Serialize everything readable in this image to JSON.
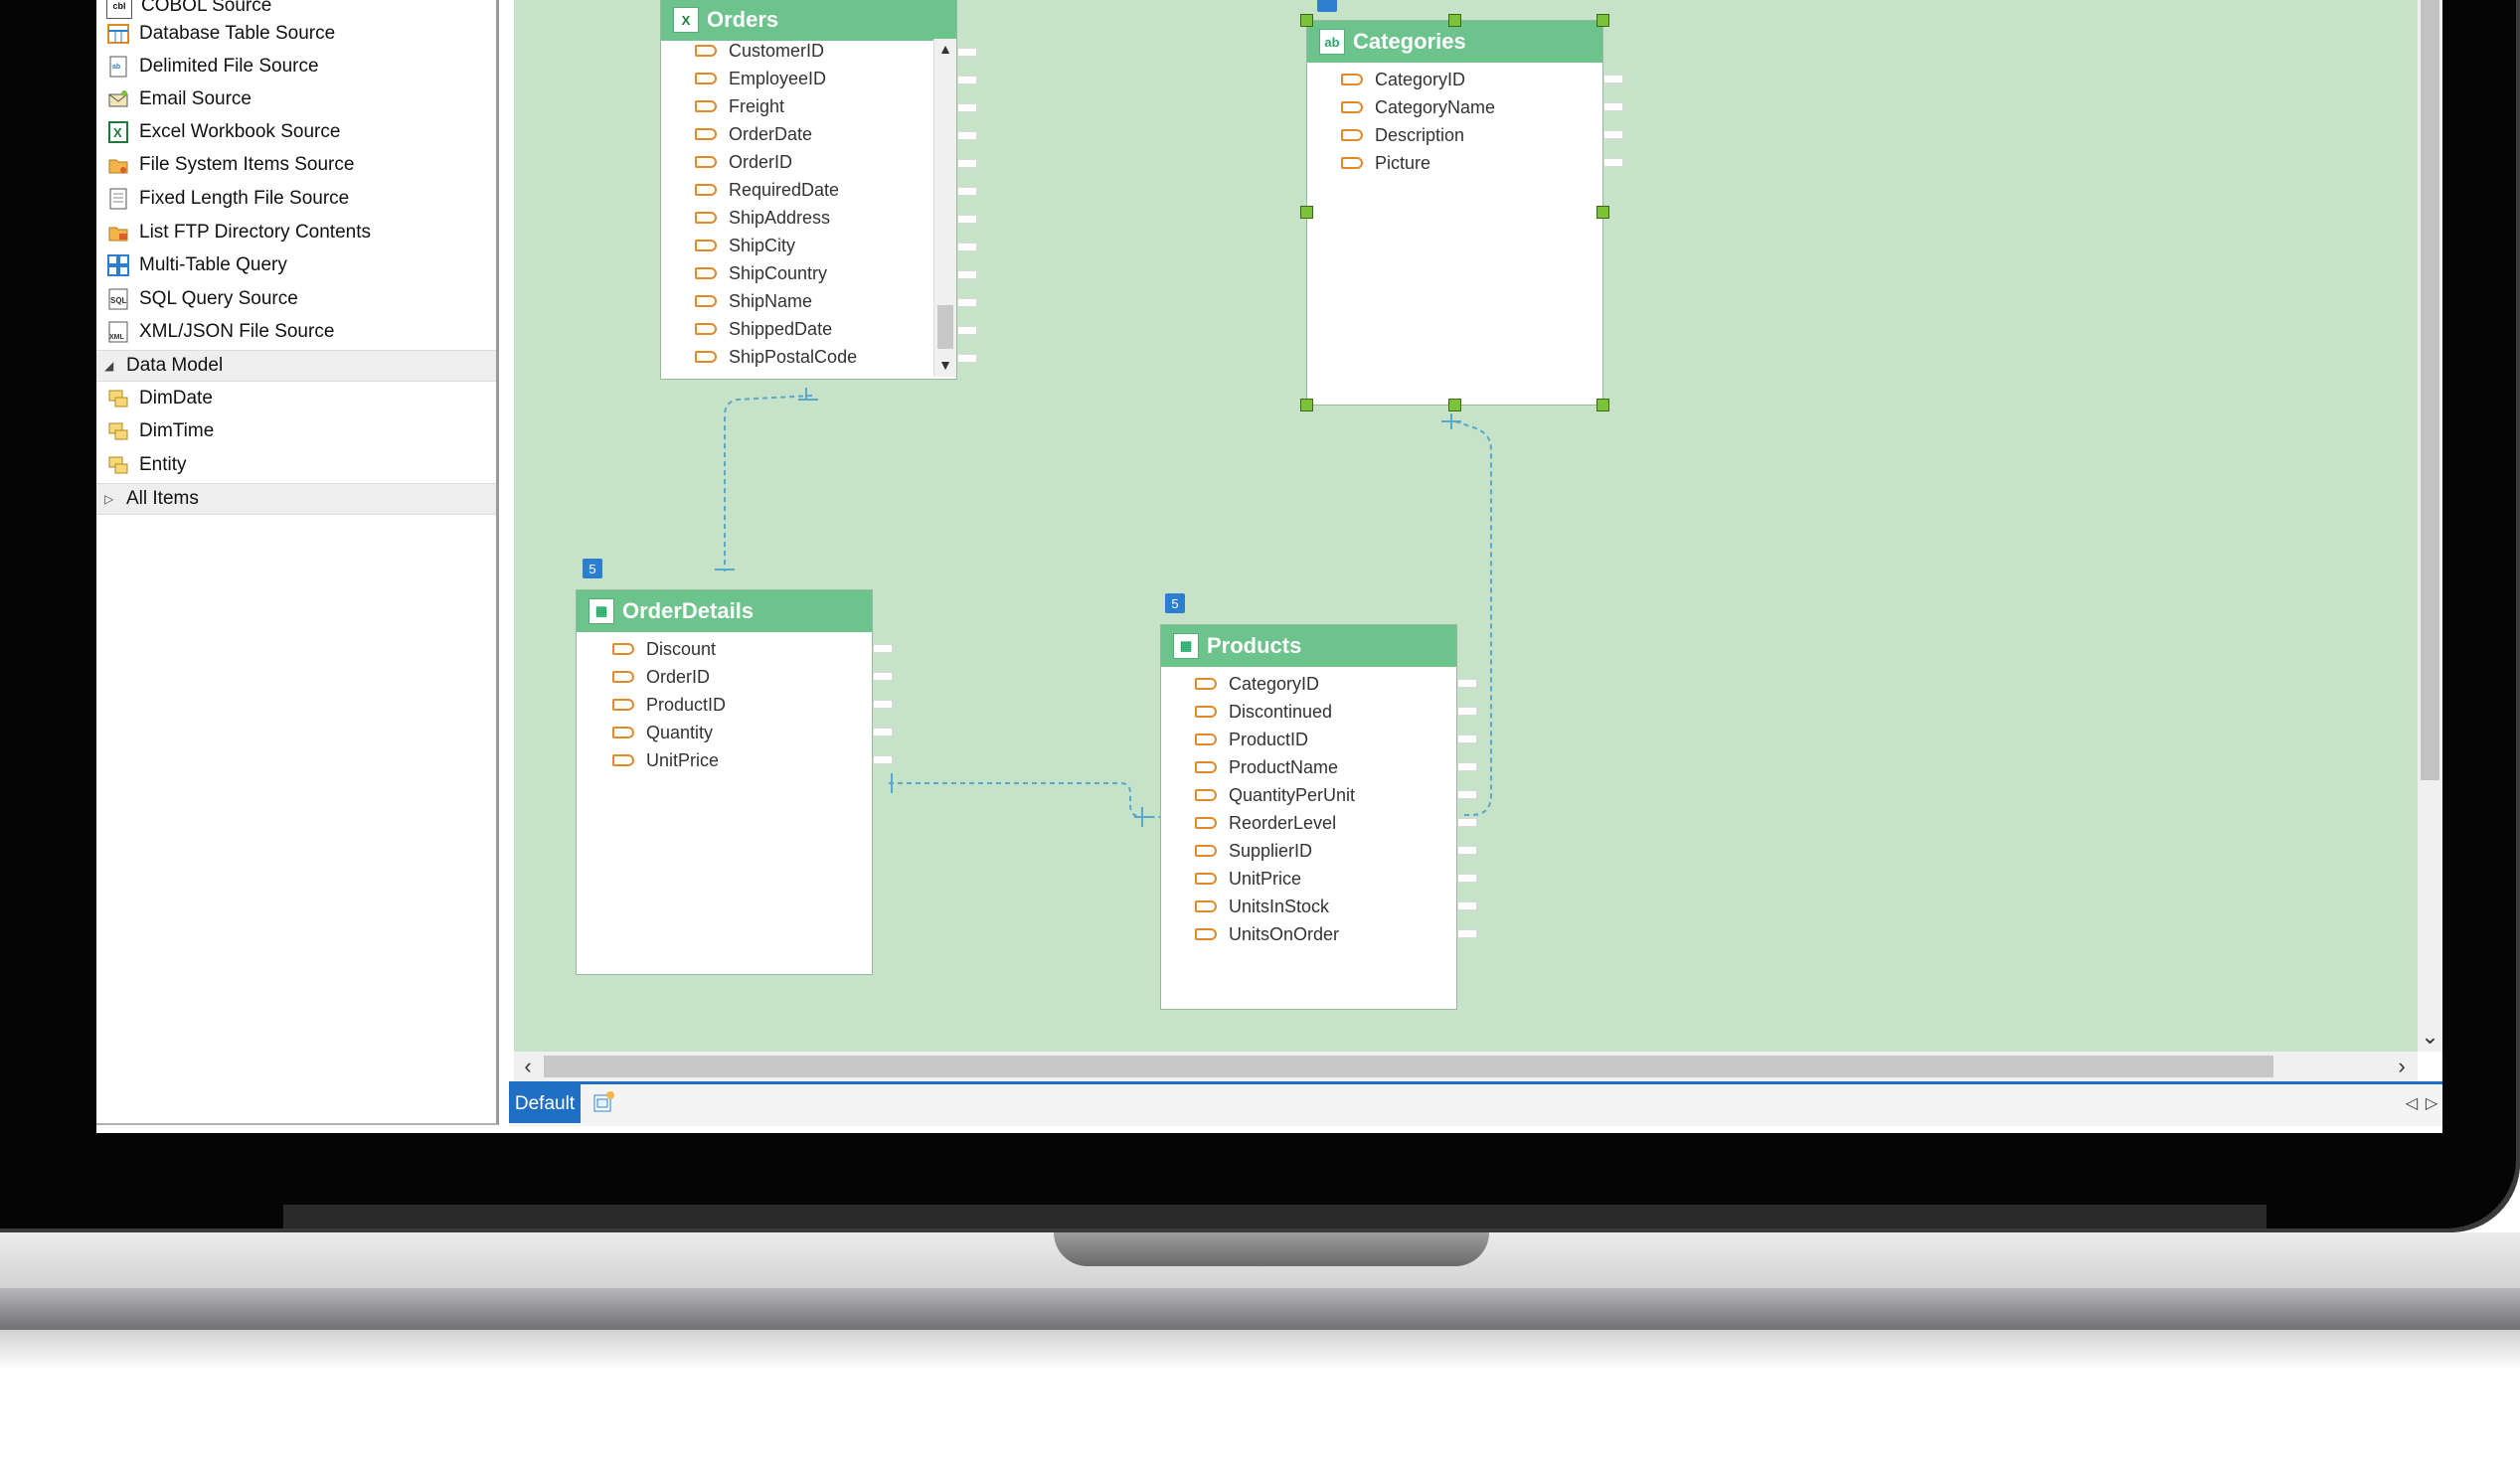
{
  "left_panel": {
    "items": [
      {
        "label": "COBOL Source",
        "icon": "cobol-icon"
      },
      {
        "label": "Database Table Source",
        "icon": "database-table-icon"
      },
      {
        "label": "Delimited File Source",
        "icon": "delimited-file-icon"
      },
      {
        "label": "Email Source",
        "icon": "email-icon"
      },
      {
        "label": "Excel Workbook Source",
        "icon": "excel-icon"
      },
      {
        "label": "File System Items Source",
        "icon": "folder-icon"
      },
      {
        "label": "Fixed Length File Source",
        "icon": "fixed-length-file-icon"
      },
      {
        "label": "List FTP Directory Contents",
        "icon": "ftp-folder-icon"
      },
      {
        "label": "Multi-Table Query",
        "icon": "multi-table-icon"
      },
      {
        "label": "SQL Query Source",
        "icon": "sql-icon"
      },
      {
        "label": "XML/JSON File Source",
        "icon": "xml-icon"
      }
    ],
    "data_model_group": "Data Model",
    "data_model_items": [
      {
        "label": "DimDate",
        "icon": "entity-icon"
      },
      {
        "label": "DimTime",
        "icon": "entity-icon"
      },
      {
        "label": "Entity",
        "icon": "entity-icon"
      }
    ],
    "all_items_group": "All Items"
  },
  "entities": {
    "orders": {
      "title": "Orders",
      "fields": [
        "CustomerID",
        "EmployeeID",
        "Freight",
        "OrderDate",
        "OrderID",
        "RequiredDate",
        "ShipAddress",
        "ShipCity",
        "ShipCountry",
        "ShipName",
        "ShippedDate",
        "ShipPostalCode"
      ]
    },
    "categories": {
      "title": "Categories",
      "fields": [
        "CategoryID",
        "CategoryName",
        "Description",
        "Picture"
      ]
    },
    "orderdetails": {
      "title": "OrderDetails",
      "badge": "5",
      "fields": [
        "Discount",
        "OrderID",
        "ProductID",
        "Quantity",
        "UnitPrice"
      ]
    },
    "products": {
      "title": "Products",
      "badge": "5",
      "fields": [
        "CategoryID",
        "Discontinued",
        "ProductID",
        "ProductName",
        "QuantityPerUnit",
        "ReorderLevel",
        "SupplierID",
        "UnitPrice",
        "UnitsInStock",
        "UnitsOnOrder"
      ]
    }
  },
  "tabs": {
    "default_label": "Default"
  },
  "colors": {
    "canvas": "#c6e2c8",
    "entity_header": "#6cc38c",
    "tab_active": "#1f6fc4",
    "relation_line": "#5aa8c8"
  }
}
